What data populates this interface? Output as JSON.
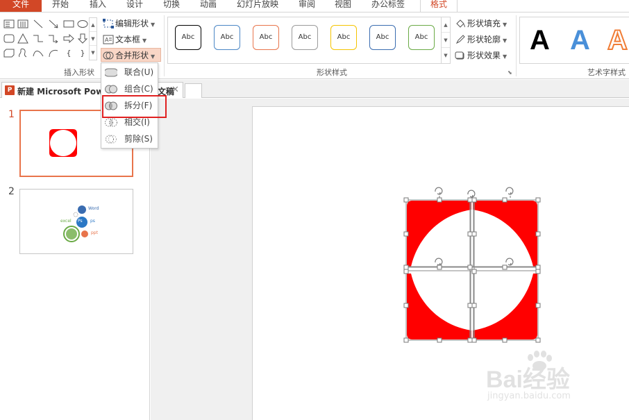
{
  "menu": {
    "tabs": [
      "文件",
      "开始",
      "插入",
      "设计",
      "切换",
      "动画",
      "幻灯片放映",
      "审阅",
      "视图",
      "办公标签",
      "格式"
    ]
  },
  "ribbon": {
    "insert_shapes": {
      "edit_shape": "编辑形状",
      "text_box": "文本框",
      "merge_shapes": "合并形状",
      "group_label": "插入形状"
    },
    "shape_styles": {
      "sample_label": "Abc",
      "group_label": "形状样式",
      "swatches": [
        "#000000",
        "#4a86c5",
        "#e8744b",
        "#9a9a9a",
        "#f5c400",
        "#3a6cb0",
        "#6aaa45"
      ],
      "fill": "形状填充",
      "outline": "形状轮廓",
      "effects": "形状效果"
    },
    "wordart": {
      "group_label": "艺术字样式",
      "letter": "A",
      "colors": [
        "#000000",
        "#4a90d9",
        "#f07d36"
      ]
    }
  },
  "document": {
    "tab_title": "新建 Microsoft PowerPoint 演示文稿",
    "app_icon_letter": "P"
  },
  "thumbnails": [
    {
      "number": "1"
    },
    {
      "number": "2",
      "labels": {
        "word": "Word",
        "ps": "ps",
        "excel": "excel",
        "ppt": "ppt",
        "ps_badge": "Ps"
      }
    }
  ],
  "merge_menu": {
    "items": [
      {
        "label": "联合(U)"
      },
      {
        "label": "组合(C)"
      },
      {
        "label": "拆分(F)"
      },
      {
        "label": "相交(I)"
      },
      {
        "label": "剪除(S)"
      }
    ]
  },
  "watermark": {
    "brand": "Bai经验",
    "site": "jingyan.baidu.com"
  },
  "colors": {
    "accent": "#d24726",
    "shape_red": "#ff0000",
    "highlight": "#e02020"
  }
}
